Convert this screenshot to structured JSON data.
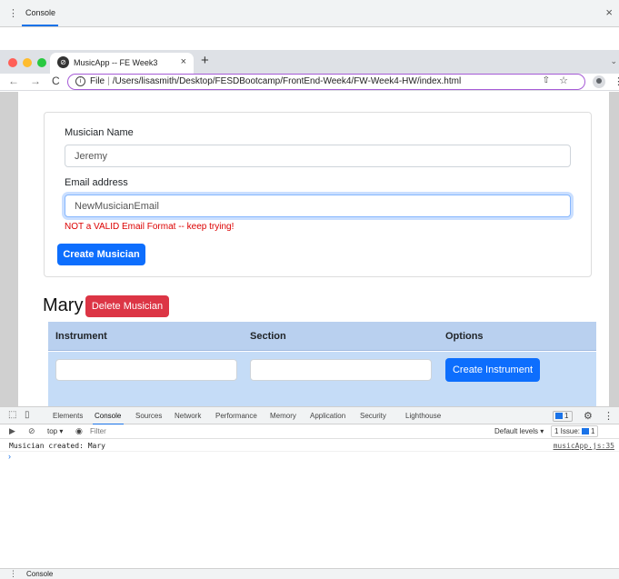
{
  "drawer_top": {
    "title": "Console",
    "menu_icon": "⋮",
    "close_icon": "×"
  },
  "browser": {
    "traffic_colors": [
      "#ff5f57",
      "#febc2e",
      "#28c840"
    ],
    "tab": {
      "title": "MusicApp -- FE Week3",
      "icon": "⊘",
      "close": "×"
    },
    "new_tab": "+",
    "tab_menu": "⌄",
    "nav": {
      "back": "←",
      "forward": "→",
      "reload": "C"
    },
    "address": {
      "scheme_label": "File",
      "separator": "|",
      "path": "/Users/lisasmith/Desktop/FESDBootcamp/FrontEnd-Week4/FW-Week4-HW/index.html",
      "info_icon": "i",
      "share_icon": "⇧",
      "star_icon": "☆"
    },
    "menu_icon": "⋮"
  },
  "form": {
    "name_label": "Musician Name",
    "name_value": "Jeremy",
    "email_label": "Email address",
    "email_value": "NewMusicianEmail",
    "error": "NOT a VALID Email Format -- keep trying!",
    "submit": "Create Musician"
  },
  "musician": {
    "name": "Mary",
    "delete_label": "Delete Musician",
    "table": {
      "headers": [
        "Instrument",
        "Section",
        "Options"
      ],
      "create_label": "Create Instrument"
    }
  },
  "devtools": {
    "tabs": [
      "Elements",
      "Console",
      "Sources",
      "Network",
      "Performance",
      "Memory",
      "Application",
      "Security",
      "Lighthouse"
    ],
    "active_tab": "Console",
    "badge_count": "1",
    "context": "top ▾",
    "filter_placeholder": "Filter",
    "levels": "Default levels ▾",
    "issues_label": "1 Issue:",
    "issues_count": "1",
    "log": {
      "message": "Musician created: Mary",
      "source": "musicApp.js:35"
    },
    "prompt": "›"
  },
  "drawer_bottom": {
    "title": "Console",
    "menu_icon": "⋮"
  }
}
